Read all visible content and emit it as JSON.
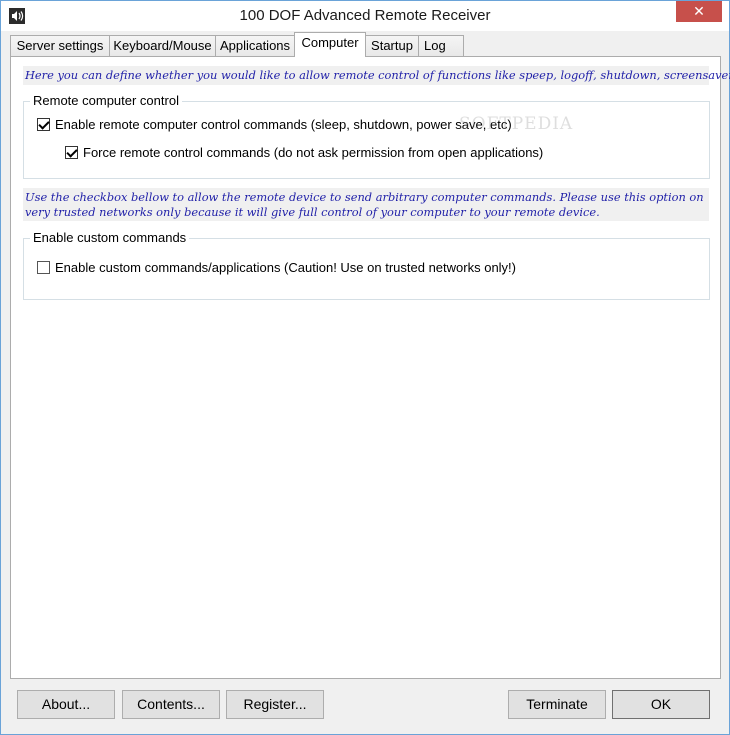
{
  "window": {
    "title": "100 DOF Advanced Remote Receiver",
    "close_symbol": "✕",
    "app_icon": "speaker-icon"
  },
  "tabs": [
    {
      "label": "Server settings",
      "active": false
    },
    {
      "label": "Keyboard/Mouse",
      "active": false
    },
    {
      "label": "Applications",
      "active": false
    },
    {
      "label": "Computer",
      "active": true
    },
    {
      "label": "Startup",
      "active": false
    },
    {
      "label": "Log",
      "active": false
    }
  ],
  "computer_tab": {
    "intro_text": "Here you can define whether you would like to allow remote control of functions like speep, logoff, shutdown, screensaver, etc.",
    "remote_group": {
      "legend": "Remote computer control",
      "enable_remote": {
        "label": "Enable remote computer control commands (sleep, shutdown, power save, etc)",
        "checked": true
      },
      "force_remote": {
        "label": "Force remote control commands (do not ask permission from open applications)",
        "checked": true
      }
    },
    "custom_info_text": "Use the checkbox bellow to allow the remote device to send arbitrary computer commands. Please use this option on very trusted networks only because it will give full control of your computer to your remote device.",
    "custom_group": {
      "legend": "Enable custom commands",
      "enable_custom": {
        "label": "Enable custom commands/applications (Caution! Use on trusted networks only!)",
        "checked": false
      }
    },
    "watermark": "SOFTPEDIA"
  },
  "buttons": {
    "about": "About...",
    "contents": "Contents...",
    "register": "Register...",
    "terminate": "Terminate",
    "ok": "OK"
  },
  "colors": {
    "info_text": "#1f1fa8",
    "close_button": "#c7504b"
  }
}
